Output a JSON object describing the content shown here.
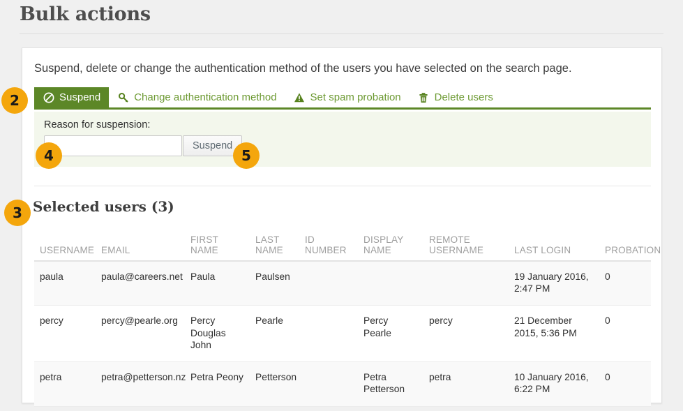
{
  "page": {
    "title": "Bulk actions"
  },
  "panel": {
    "intro": "Suspend, delete or change the authentication method of the users you have selected on the search page.",
    "tabs": [
      {
        "label": "Suspend",
        "icon": "ban-icon",
        "active": true
      },
      {
        "label": "Change authentication method",
        "icon": "key-icon",
        "active": false
      },
      {
        "label": "Set spam probation",
        "icon": "warning-triangle-icon",
        "active": false
      },
      {
        "label": "Delete users",
        "icon": "trash-icon",
        "active": false
      }
    ],
    "form": {
      "reason_label": "Reason for suspension:",
      "reason_value": "",
      "reason_placeholder": "",
      "submit_label": "Suspend"
    },
    "selected_users_heading": "Selected users (3)",
    "table": {
      "columns": [
        "USERNAME",
        "EMAIL",
        "FIRST NAME",
        "LAST NAME",
        "ID NUMBER",
        "DISPLAY NAME",
        "REMOTE USERNAME",
        "LAST LOGIN",
        "PROBATION"
      ],
      "rows": [
        {
          "username": "paula",
          "email": "paula@careers.net",
          "first_name": "Paula",
          "last_name": "Paulsen",
          "id_number": "",
          "display_name": "",
          "remote_username": "",
          "last_login": "19 January 2016, 2:47 PM",
          "probation": "0"
        },
        {
          "username": "percy",
          "email": "percy@pearle.org",
          "first_name": "Percy Douglas John",
          "last_name": "Pearle",
          "id_number": "",
          "display_name": "Percy Pearle",
          "remote_username": "percy",
          "last_login": "21 December 2015, 5:36 PM",
          "probation": "0"
        },
        {
          "username": "petra",
          "email": "petra@petterson.nz",
          "first_name": "Petra Peony",
          "last_name": "Petterson",
          "id_number": "",
          "display_name": "Petra Petterson",
          "remote_username": "petra",
          "last_login": "10 January 2016, 6:22 PM",
          "probation": "0"
        }
      ]
    }
  },
  "callouts": [
    {
      "number": "2"
    },
    {
      "number": "3"
    },
    {
      "number": "4"
    },
    {
      "number": "5"
    }
  ],
  "colors": {
    "accent_green": "#5c8727",
    "tab_link_green": "#6d9a33",
    "badge_orange": "#f4a60c",
    "form_background": "#f3f7ec",
    "page_background": "#f0f0f0"
  }
}
